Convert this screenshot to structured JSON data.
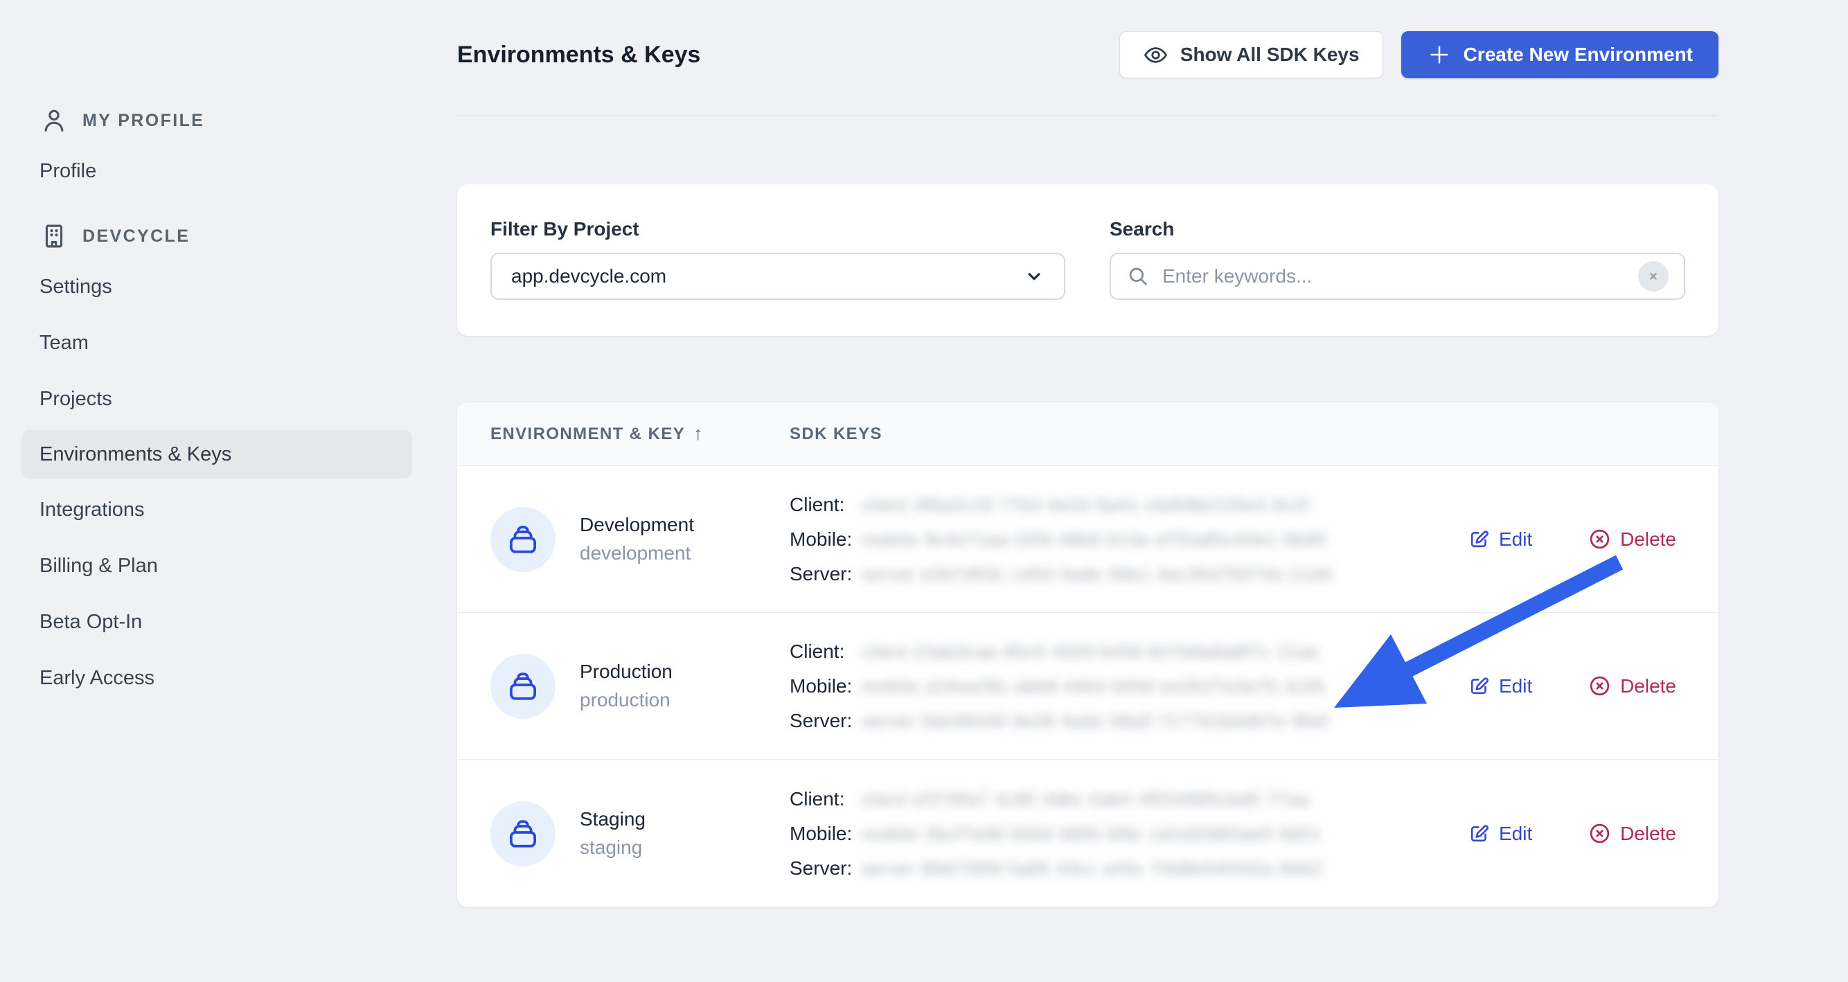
{
  "header": {
    "title": "Environments & Keys",
    "show_keys_label": "Show All SDK Keys",
    "create_label": "Create New Environment"
  },
  "sidebar": {
    "profile_header": "MY PROFILE",
    "org_header": "DEVCYCLE",
    "profile_items": [
      {
        "label": "Profile",
        "selected": false
      }
    ],
    "org_items": [
      {
        "label": "Settings",
        "selected": false
      },
      {
        "label": "Team",
        "selected": false
      },
      {
        "label": "Projects",
        "selected": false
      },
      {
        "label": "Environments & Keys",
        "selected": true
      },
      {
        "label": "Integrations",
        "selected": false
      },
      {
        "label": "Billing & Plan",
        "selected": false
      },
      {
        "label": "Beta Opt-In",
        "selected": false
      },
      {
        "label": "Early Access",
        "selected": false
      }
    ]
  },
  "filters": {
    "project_label": "Filter By Project",
    "project_value": "app.devcycle.com",
    "search_label": "Search",
    "search_placeholder": "Enter keywords...",
    "search_value": ""
  },
  "table": {
    "col_env": "ENVIRONMENT & KEY",
    "sort_icon": "↑",
    "col_keys": "SDK KEYS",
    "label_client": "Client:",
    "label_mobile": "Mobile:",
    "label_server": "Server:",
    "action_edit": "Edit",
    "action_delete": "Delete",
    "rows": [
      {
        "name": "Development",
        "key": "development",
        "client": "client 4f8a2c19 77b3 4e2d 9a41 c6d58b21f0e3 8c2f",
        "mobile": "mobile 9c4e71aa 02fd 48b6 b13e d7f2a85c40e1 6b90",
        "server": "server e2b7d03c c45d 4ade 58e1 4ac35d7b074a 21dd"
      },
      {
        "name": "Production",
        "key": "production",
        "client": "client 23ab3cae 85c5 4929 b456 827b8a8a8f7c 11aa",
        "mobile": "mobile a24ea28c abb8 44b4 b93d ee2fcf7e3a7b 3c55",
        "server": "server 0dc08448 9e28 4ade 08a9 717761b0d67e 90ef"
      },
      {
        "name": "Staging",
        "key": "staging",
        "client": "client ef276fa7 4c80 4dbc 0ab4 4f034985cbd5 77aa",
        "mobile": "mobile 2bcf7e08 934d 4895 bf6c 1d1d258f2ae5 0d21",
        "server": "server 89d739fd 5a85 43cc a45c 70d8e54f432a 66b2"
      }
    ]
  },
  "colors": {
    "page_background": "#EFF1F4",
    "primary_button_blue": "#3A60D8",
    "annotation_arrow_blue": "#2F62E9",
    "edit_link_blue": "#3546CF",
    "delete_link_crimson": "#B02A59",
    "environment_icon_blue": "#2B49D8",
    "environment_badge_background": "#E8F0FC",
    "selected_sidebar_item_background": "#E5E7EA"
  }
}
